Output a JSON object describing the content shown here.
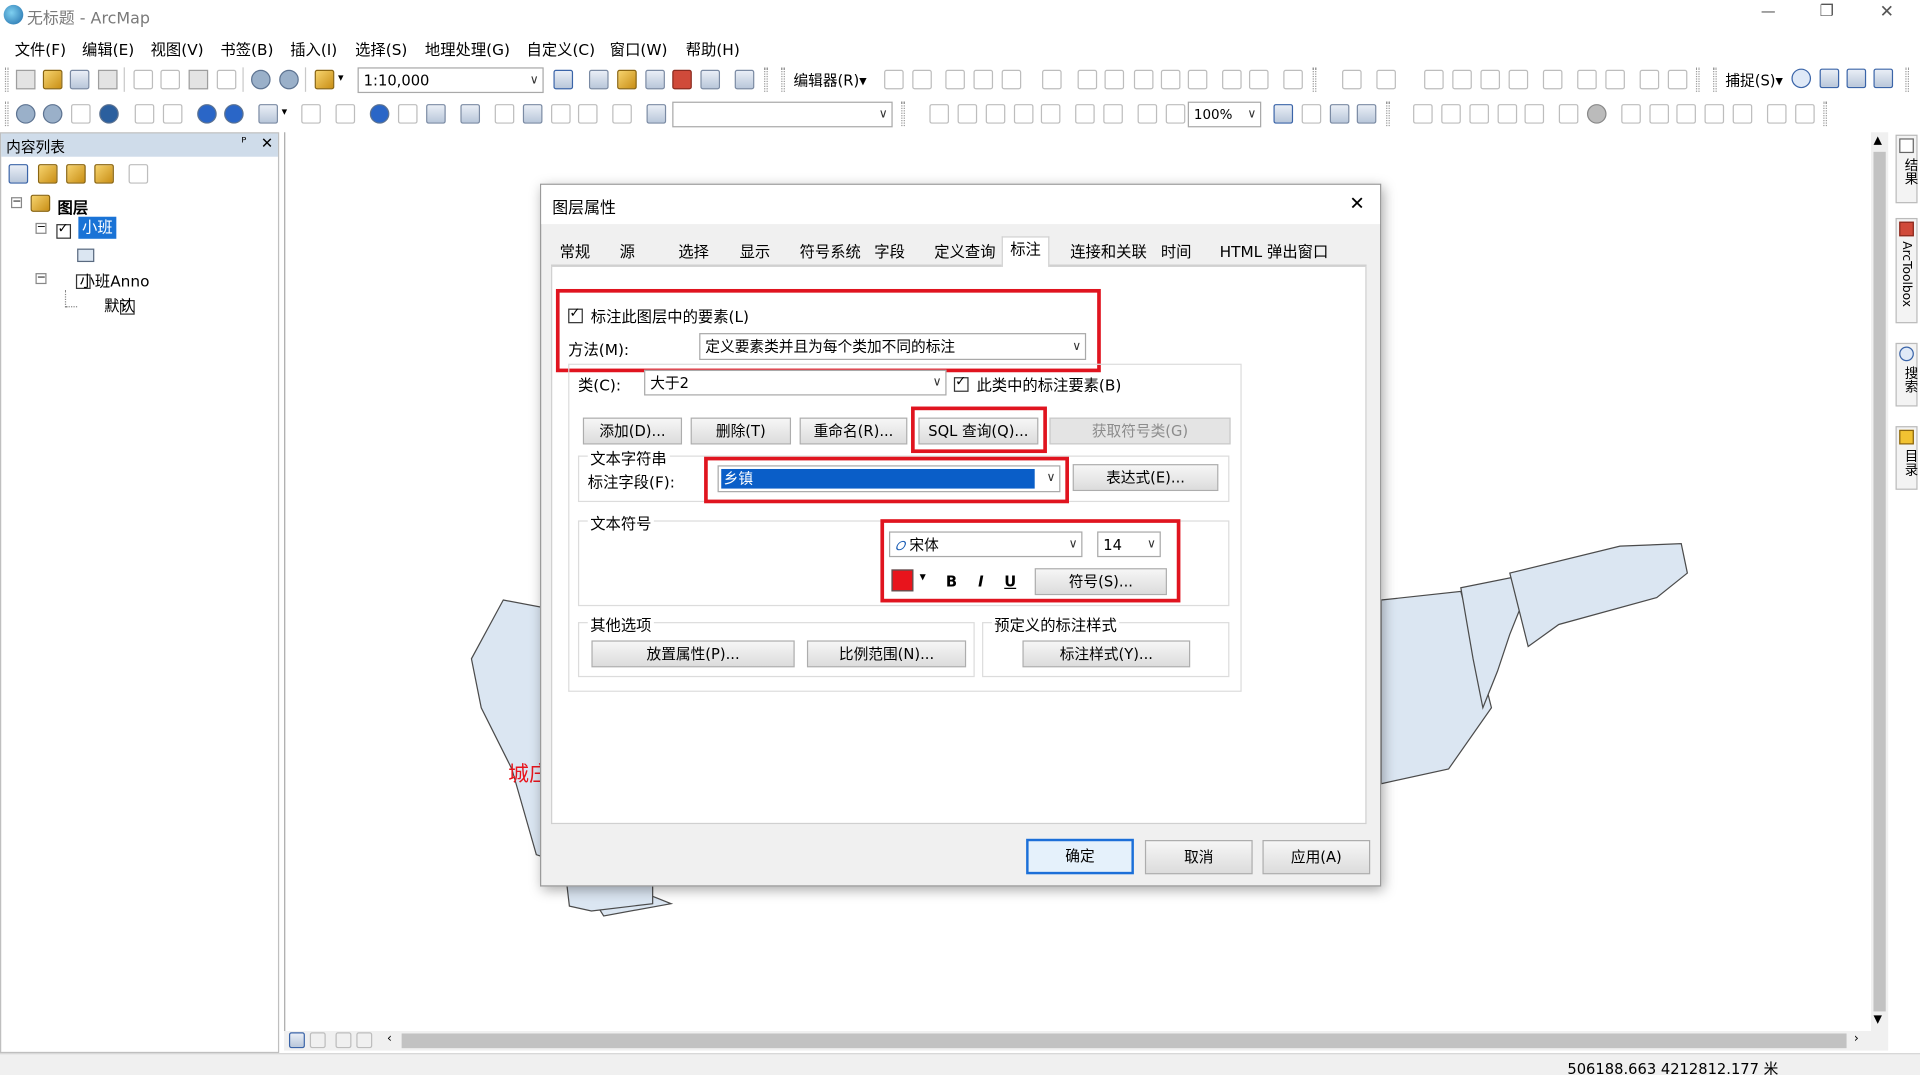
{
  "window": {
    "title": "无标题 - ArcMap",
    "controls": {
      "minimize": "—",
      "restore": "❐",
      "close": "✕"
    }
  },
  "menubar": [
    "文件(F)",
    "编辑(E)",
    "视图(V)",
    "书签(B)",
    "插入(I)",
    "选择(S)",
    "地理处理(G)",
    "自定义(C)",
    "窗口(W)",
    "帮助(H)"
  ],
  "toolbar": {
    "scale_value": "1:10,000",
    "editor_label": "编辑器(R)▾",
    "snap_label": "捕捉(S)▾",
    "zoom_value": "100%"
  },
  "toc": {
    "title": "内容列表",
    "pin": "ᴾ",
    "close": "✕",
    "root": "图层",
    "layer1": "小班",
    "layer2": "小班Anno",
    "layer2_child": "默认"
  },
  "map": {
    "label": "城庄",
    "coords": "506188.663  4212812.177 米"
  },
  "side_tabs": [
    "结果",
    "ArcToolbox",
    "搜索",
    "目录"
  ],
  "dialog": {
    "title": "图层属性",
    "close": "✕",
    "tabs": [
      "常规",
      "源",
      "选择",
      "显示",
      "符号系统",
      "字段",
      "定义查询",
      "标注",
      "连接和关联",
      "时间",
      "HTML 弹出窗口"
    ],
    "active_tab": "标注",
    "label_features": "标注此图层中的要素(L)",
    "method_label": "方法(M):",
    "method_value": "定义要素类并且为每个类加不同的标注",
    "class_label": "类(C):",
    "class_value": "大于2",
    "class_label_features": "此类中的标注要素(B)",
    "btn_add": "添加(D)...",
    "btn_delete": "删除(T)",
    "btn_rename": "重命名(R)...",
    "btn_sql": "SQL 查询(Q)...",
    "btn_get_symbol": "获取符号类(G)",
    "text_string_group": "文本字符串",
    "label_field_label": "标注字段(F):",
    "label_field_value": "乡镇",
    "btn_expression": "表达式(E)...",
    "text_symbol_group": "文本符号",
    "font_value": "宋体",
    "size_value": "14",
    "font_color": "#e8141c",
    "bold": "B",
    "italic": "I",
    "underline": "U",
    "btn_symbol": "符号(S)...",
    "other_options_group": "其他选项",
    "btn_placement": "放置属性(P)...",
    "btn_scale_range": "比例范围(N)...",
    "predefined_group": "预定义的标注样式",
    "btn_label_styles": "标注样式(Y)...",
    "btn_ok": "确定",
    "btn_cancel": "取消",
    "btn_apply": "应用(A)"
  }
}
